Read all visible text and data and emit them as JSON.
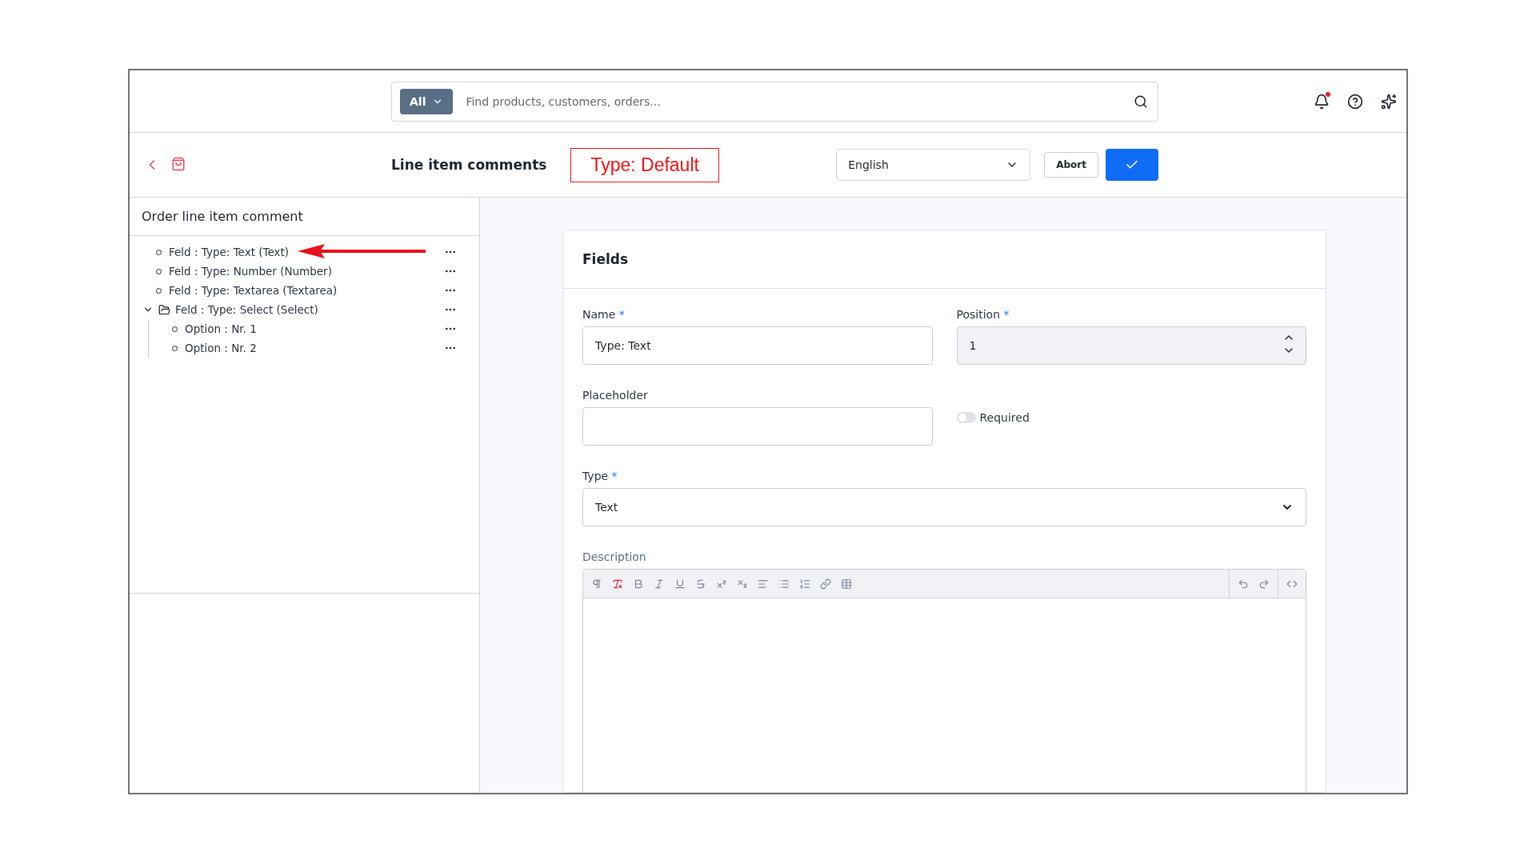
{
  "search": {
    "scope": "All",
    "placeholder": "Find products, customers, orders..."
  },
  "header_icons": {
    "notification_dot": true
  },
  "toolbar": {
    "title": "Line item comments",
    "annotation_label": "Type: Default",
    "language": "English",
    "abort": "Abort"
  },
  "sidebar": {
    "title": "Order line item comment",
    "items": [
      {
        "label": "Feld : Type: Text (Text)",
        "annotated": true
      },
      {
        "label": "Feld : Type: Number (Number)"
      },
      {
        "label": "Feld : Type: Textarea (Textarea)"
      },
      {
        "label": "Feld : Type: Select (Select)",
        "expanded": true,
        "children": [
          {
            "label": "Option : Nr. 1"
          },
          {
            "label": "Option : Nr. 2"
          }
        ]
      }
    ]
  },
  "card": {
    "title": "Fields",
    "name": {
      "label": "Name",
      "required_mark": "*",
      "value": "Type: Text"
    },
    "position": {
      "label": "Position",
      "required_mark": "*",
      "value": "1"
    },
    "placeholder": {
      "label": "Placeholder"
    },
    "required_toggle": {
      "label": "Required",
      "on": false
    },
    "type": {
      "label": "Type",
      "required_mark": "*",
      "value": "Text"
    },
    "description": {
      "label": "Description"
    }
  }
}
